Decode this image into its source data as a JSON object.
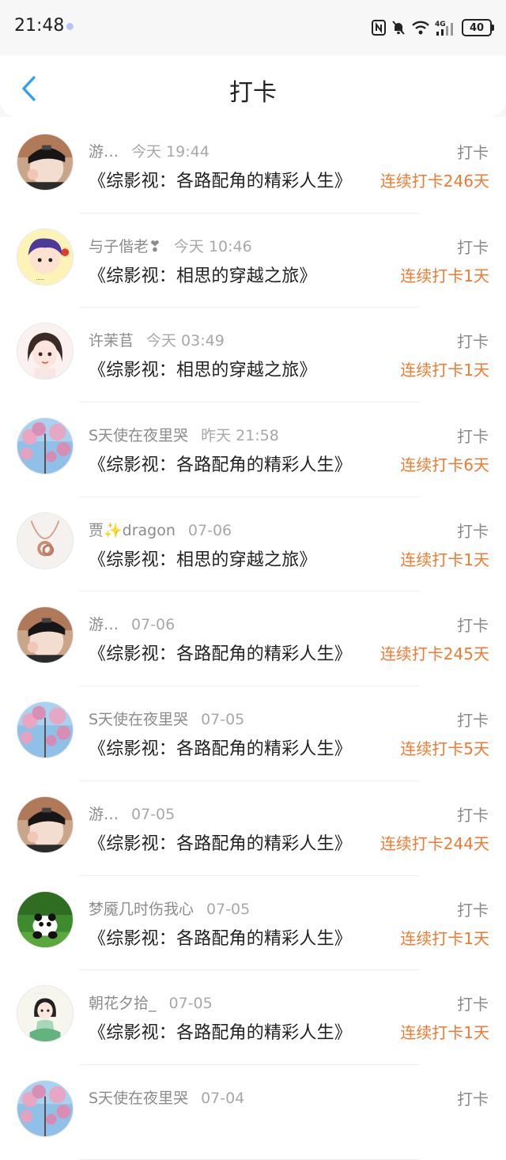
{
  "status_bar": {
    "time": "21:48",
    "battery": "40"
  },
  "header": {
    "title": "打卡",
    "back_icon": "chevron-left-icon",
    "accent": "#2e9df7"
  },
  "colors": {
    "streak": "#f07a2f",
    "meta": "#8c8c8c"
  },
  "items": [
    {
      "user": "游…",
      "time": "今天 19:44",
      "tag": "打卡",
      "book": "《综影视：各路配角的精彩人生》",
      "streak": "连续打卡246天",
      "avatar": "person-cap"
    },
    {
      "user": "与子偕老❣",
      "time": "今天 10:46",
      "tag": "打卡",
      "book": "《综影视：相思的穿越之旅》",
      "streak": "连续打卡1天",
      "avatar": "cartoon-boy"
    },
    {
      "user": "许茉苢",
      "time": "今天 03:49",
      "tag": "打卡",
      "book": "《综影视：相思的穿越之旅》",
      "streak": "连续打卡1天",
      "avatar": "cartoon-girl"
    },
    {
      "user": "S天使在夜里哭",
      "time": "昨天 21:58",
      "tag": "打卡",
      "book": "《综影视：各路配角的精彩人生》",
      "streak": "连续打卡6天",
      "avatar": "blossom-sky"
    },
    {
      "user": "贾✨dragon",
      "time": "07-06",
      "tag": "打卡",
      "book": "《综影视：相思的穿越之旅》",
      "streak": "连续打卡1天",
      "avatar": "necklace"
    },
    {
      "user": "游…",
      "time": "07-06",
      "tag": "打卡",
      "book": "《综影视：各路配角的精彩人生》",
      "streak": "连续打卡245天",
      "avatar": "person-cap"
    },
    {
      "user": "S天使在夜里哭",
      "time": "07-05",
      "tag": "打卡",
      "book": "《综影视：各路配角的精彩人生》",
      "streak": "连续打卡5天",
      "avatar": "blossom-sky"
    },
    {
      "user": "游…",
      "time": "07-05",
      "tag": "打卡",
      "book": "《综影视：各路配角的精彩人生》",
      "streak": "连续打卡244天",
      "avatar": "person-cap"
    },
    {
      "user": "梦魇几时伤我心",
      "time": "07-05",
      "tag": "打卡",
      "book": "《综影视：各路配角的精彩人生》",
      "streak": "连续打卡1天",
      "avatar": "panda"
    },
    {
      "user": "朝花夕拾_",
      "time": "07-05",
      "tag": "打卡",
      "book": "《综影视：各路配角的精彩人生》",
      "streak": "连续打卡1天",
      "avatar": "cartoon-lady"
    },
    {
      "user": "S天使在夜里哭",
      "time": "07-04",
      "tag": "打卡",
      "book": "",
      "streak": "",
      "avatar": "blossom-sky"
    }
  ]
}
